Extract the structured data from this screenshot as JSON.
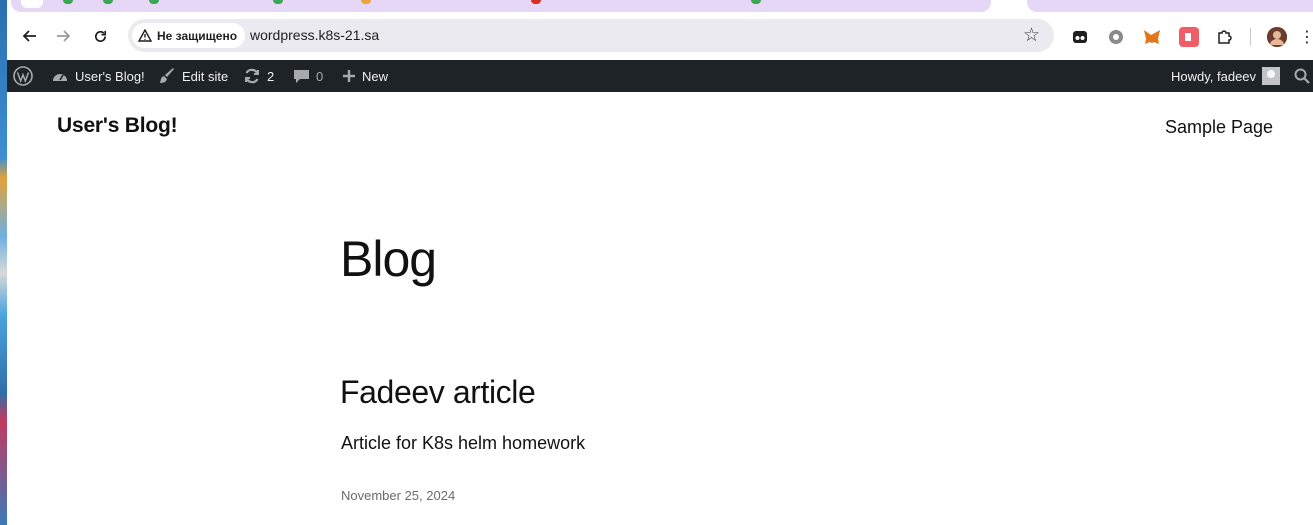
{
  "browser": {
    "security_label": "Не защищено",
    "url": "wordpress.k8s-21.sa"
  },
  "icons": {
    "back": "arrow-left-icon",
    "forward": "arrow-right-icon",
    "reload": "reload-icon",
    "warning": "warning-triangle-icon",
    "bookmark": "star-icon"
  },
  "adminbar": {
    "site_name": "User's Blog!",
    "edit_site": "Edit site",
    "updates_count": "2",
    "comments_count": "0",
    "new_label": "New",
    "howdy": "Howdy, fadeev"
  },
  "site": {
    "title": "User's Blog!",
    "nav_item": "Sample Page"
  },
  "main": {
    "page_title": "Blog",
    "posts": [
      {
        "title": "Fadeev article",
        "excerpt": "Article for K8s helm homework",
        "date": "November 25, 2024"
      }
    ]
  },
  "colors": {
    "adminbar_bg": "#1d2327",
    "tabstrip_bg": "#e7d7f6",
    "omnibox_bg": "#ebeaf0",
    "text": "#111111"
  }
}
